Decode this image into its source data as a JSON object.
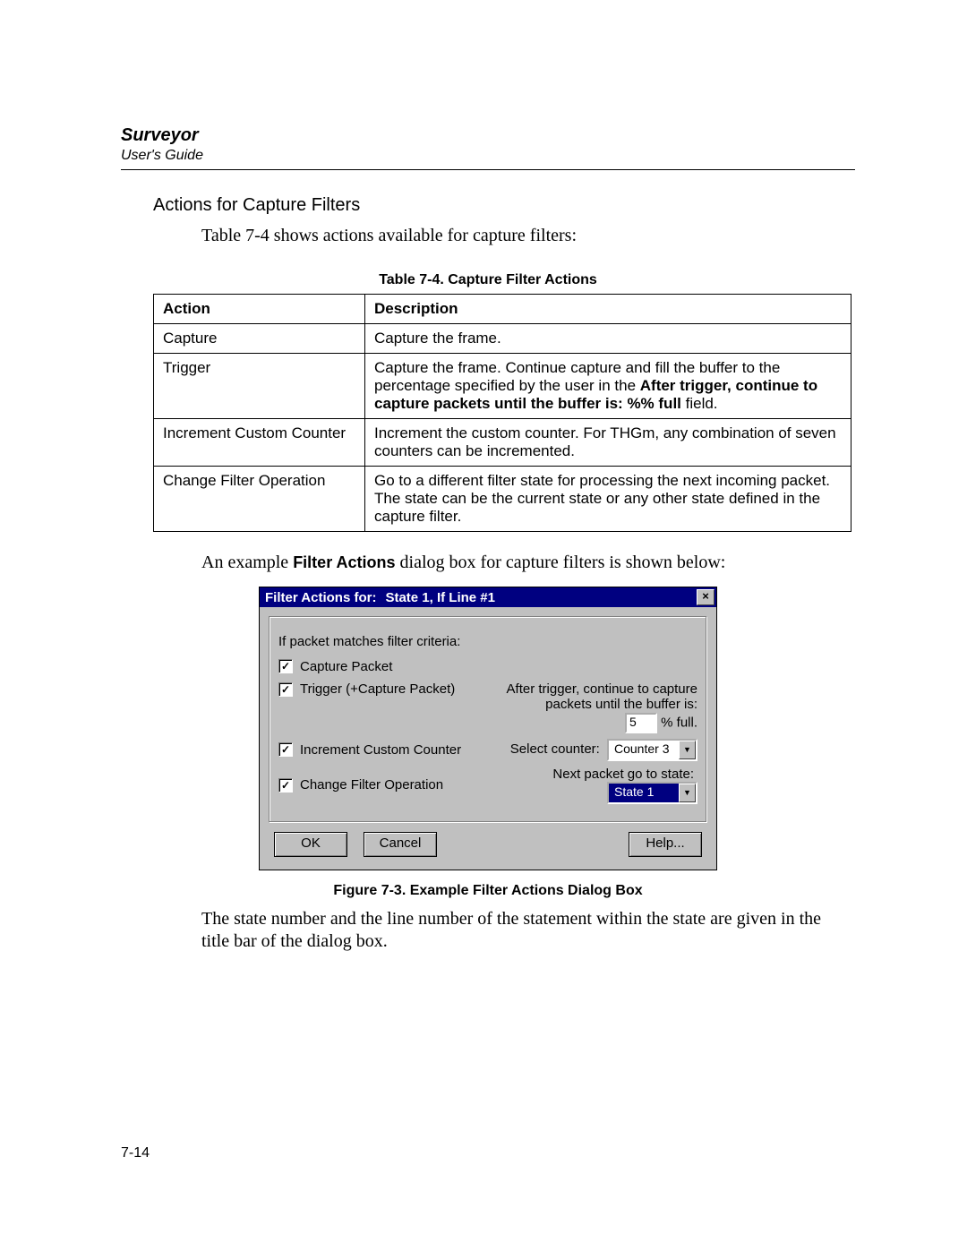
{
  "header": {
    "product": "Surveyor",
    "subtitle": "User's Guide"
  },
  "section_heading": "Actions for Capture Filters",
  "intro_text": "Table 7-4 shows actions available for capture filters:",
  "table_caption": "Table 7-4. Capture Filter Actions",
  "table": {
    "cols": {
      "action": "Action",
      "description": "Description"
    },
    "rows": [
      {
        "action": "Capture",
        "desc": "Capture the frame."
      },
      {
        "action": "Trigger",
        "desc_pre": "Capture the frame. Continue capture and fill the buffer to the percentage specified by the user in the ",
        "desc_bold": "After trigger, continue to capture packets until the buffer is: %% full",
        "desc_post": " field."
      },
      {
        "action": "Increment Custom Counter",
        "desc": "Increment the custom counter. For THGm, any combination of seven counters can be incremented."
      },
      {
        "action": "Change Filter Operation",
        "desc": "Go to a different filter state for processing the next incoming packet. The state can be the current state or any other state defined in the capture filter."
      }
    ]
  },
  "example_intro_pre": "An example ",
  "example_intro_bold": "Filter Actions",
  "example_intro_post": " dialog box for capture filters is shown below:",
  "dialog": {
    "title_label": "Filter Actions for:",
    "title_value": "State 1, If Line #1",
    "close_glyph": "×",
    "group_label": "If packet matches filter criteria:",
    "capture_label": "Capture Packet",
    "trigger_label": "Trigger (+Capture Packet)",
    "trigger_text_l1": "After trigger, continue to capture",
    "trigger_text_l2": "packets until the buffer is:",
    "buffer_value": "5",
    "buffer_suffix": "% full.",
    "increment_label": "Increment Custom Counter",
    "select_counter_label": "Select counter:",
    "counter_value": "Counter 3",
    "change_label": "Change Filter Operation",
    "next_state_label": "Next packet go to state:",
    "state_value": "State 1",
    "ok": "OK",
    "cancel": "Cancel",
    "help": "Help...",
    "check_glyph": "✓",
    "arrow_glyph": "▼"
  },
  "figure_caption": "Figure 7-3. Example Filter Actions Dialog Box",
  "closing_text": "The state number and the line number of the statement within the state are given in the title bar of the dialog box.",
  "page_number": "7-14"
}
